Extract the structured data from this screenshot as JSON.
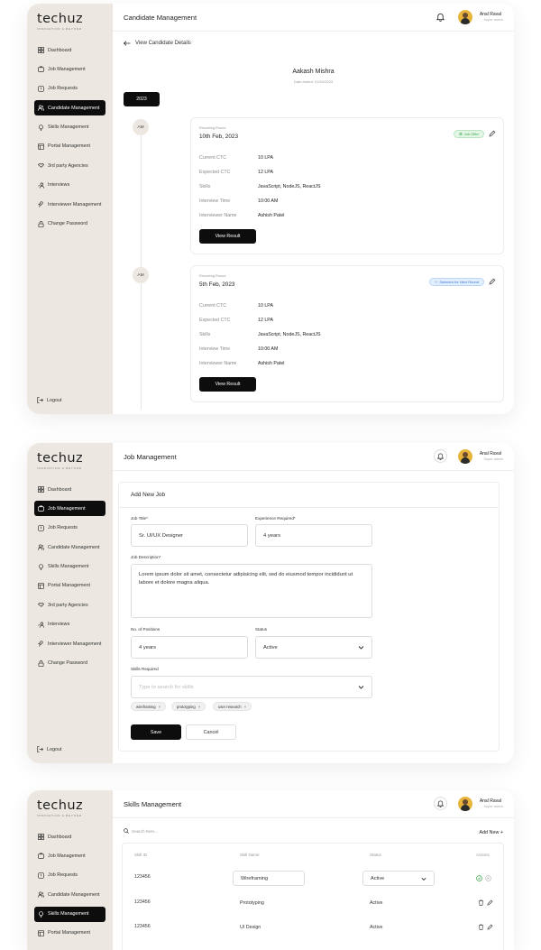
{
  "app": {
    "logo": "techuz",
    "logo_sub": "INNOVATION & BEYOND",
    "user_name": "Anal Raval",
    "user_role": "Super admin",
    "logout": "Logout"
  },
  "nav": [
    {
      "label": "Dashboard",
      "icon": "grid-icon"
    },
    {
      "label": "Job Management",
      "icon": "briefcase-icon"
    },
    {
      "label": "Job Requests",
      "icon": "request-icon"
    },
    {
      "label": "Candidate Management",
      "icon": "users-icon"
    },
    {
      "label": "Skills Management",
      "icon": "bulb-icon"
    },
    {
      "label": "Portal Management",
      "icon": "portal-icon"
    },
    {
      "label": "3rd party Agencies",
      "icon": "handshake-icon"
    },
    {
      "label": "Interviews",
      "icon": "interviews-icon"
    },
    {
      "label": "Interviewer Management",
      "icon": "interviewer-icon"
    },
    {
      "label": "Change Password",
      "icon": "lock-icon"
    }
  ],
  "screen1": {
    "title": "Candidate Management",
    "back_label": "View Candidate Details",
    "candidate_name": "Aakash Mishra",
    "date_added": "Date Added: 01/02/2023",
    "year": "2023",
    "rounds": [
      {
        "time": "AM",
        "round_label": "Resuming Round",
        "date": "10th Feb, 2023",
        "badge": "Job Offer",
        "rows": [
          {
            "label": "Current CTC",
            "value": "10 LPA"
          },
          {
            "label": "Expected CTC",
            "value": "12 LPA"
          },
          {
            "label": "Skills",
            "value": "JavaScript, NodeJS, ReactJS"
          },
          {
            "label": "Interview Time",
            "value": "10:00 AM"
          },
          {
            "label": "Interviewer Name",
            "value": "Ashish Patel"
          }
        ],
        "button": "View Result"
      },
      {
        "time": "AM",
        "round_label": "Resuming Round",
        "date": "5th Feb, 2023",
        "badge": "Selected for Next Round",
        "rows": [
          {
            "label": "Current CTC",
            "value": "10 LPA"
          },
          {
            "label": "Expected CTC",
            "value": "12 LPA"
          },
          {
            "label": "Skills",
            "value": "JavaScript, NodeJS, ReactJS"
          },
          {
            "label": "Interview Time",
            "value": "10:00 AM"
          },
          {
            "label": "Interviewer Name",
            "value": "Ashish Patel"
          }
        ],
        "button": "View Result"
      }
    ]
  },
  "screen2": {
    "title": "Job Management",
    "card_title": "Add New Job",
    "job_title_label": "Job Title*",
    "job_title_value": "Sr. UI/UX Designer",
    "experience_label": "Experience Required*",
    "experience_value": "4 years",
    "description_label": "Job Description*",
    "description_value": "Lorem ipsum dolor sit amet, consectetur adipisicing elit, sed do eiusmod tempor incididunt ut labore et dolore magna aliqua.",
    "positions_label": "No. of Positions",
    "positions_value": "4 years",
    "status_label": "Status",
    "status_value": "Active",
    "skills_label": "Skills Required",
    "skills_placeholder": "Type to search for skills",
    "chips": [
      "wireframing",
      "prototyping",
      "user research"
    ],
    "save": "Save",
    "cancel": "Cancel"
  },
  "screen3": {
    "title": "Skills Management",
    "search_placeholder": "Search here...",
    "add_new": "Add New +",
    "columns": [
      "Skill ID",
      "Skill Name",
      "Status",
      "Actions"
    ],
    "rows": [
      {
        "id": "123456",
        "name": "Wireframing",
        "status": "Active",
        "editing": true
      },
      {
        "id": "123456",
        "name": "Prototyping",
        "status": "Active",
        "editing": false
      },
      {
        "id": "123456",
        "name": "UI Design",
        "status": "Active",
        "editing": false
      }
    ]
  }
}
